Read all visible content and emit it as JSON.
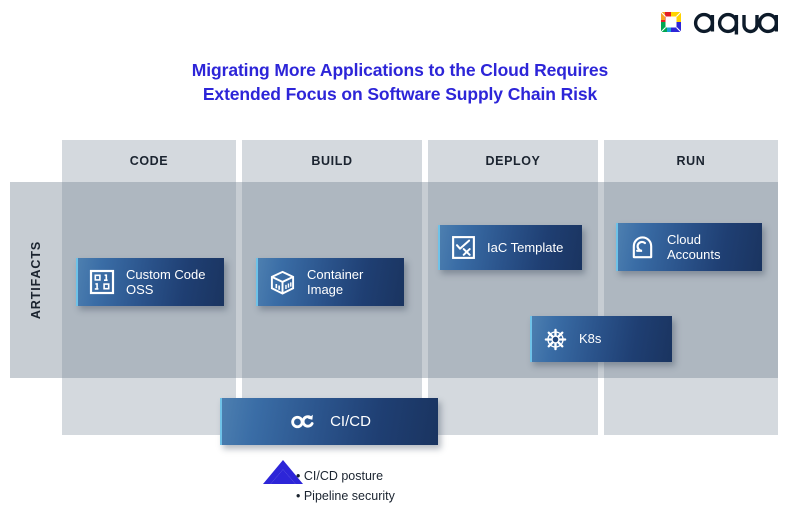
{
  "brand": {
    "name": "aqua",
    "logo_icon": "aqua-logo-mark",
    "mark_colors": [
      "#e31e24",
      "#f5a623",
      "#ffd400",
      "#00a651",
      "#1b9fd8",
      "#2d25d8"
    ]
  },
  "title": {
    "line1": "Migrating More Applications to the Cloud Requires",
    "line2": "Extended Focus on Software Supply Chain Risk",
    "color": "#2d25d8"
  },
  "diagram": {
    "row_label": "ARTIFACTS",
    "stages": [
      {
        "label": "CODE"
      },
      {
        "label": "BUILD"
      },
      {
        "label": "DEPLOY"
      },
      {
        "label": "RUN"
      }
    ],
    "cards": [
      {
        "id": "custom-code-oss",
        "label": "Custom Code\nOSS",
        "label_line1": "Custom Code",
        "label_line2": "OSS",
        "icon": "binary-code-icon",
        "stage": "CODE"
      },
      {
        "id": "container-image",
        "label": "Container\nImage",
        "label_line1": "Container",
        "label_line2": "Image",
        "icon": "container-box-icon",
        "stage": "BUILD"
      },
      {
        "id": "iac-template",
        "label": "IaC Template",
        "label_line1": "IaC Template",
        "label_line2": "",
        "icon": "check-x-square-icon",
        "stage": "DEPLOY"
      },
      {
        "id": "cloud-accounts",
        "label": "Cloud\nAccounts",
        "label_line1": "Cloud",
        "label_line2": "Accounts",
        "icon": "cloud-lock-icon",
        "stage": "RUN"
      },
      {
        "id": "k8s",
        "label": "K8s",
        "label_line1": "K8s",
        "label_line2": "",
        "icon": "kubernetes-helm-icon",
        "stage": "DEPLOY"
      },
      {
        "id": "cicd",
        "label": "CI/CD",
        "label_line1": "CI/CD",
        "label_line2": "",
        "icon": "infinity-loop-icon",
        "stage": "BUILD-DEPLOY"
      }
    ],
    "card_gradient_from": "#4d7fb0",
    "card_gradient_to": "#1a3460",
    "card_accent": "#6fc2e8",
    "column_bg": "#d4d9de",
    "band_bg": "#9aa6b3"
  },
  "footnote": {
    "marker_icon": "chevron-up-icon",
    "marker_color": "#2d25d8",
    "bullets": [
      "• CI/CD posture",
      "• Pipeline security"
    ]
  }
}
